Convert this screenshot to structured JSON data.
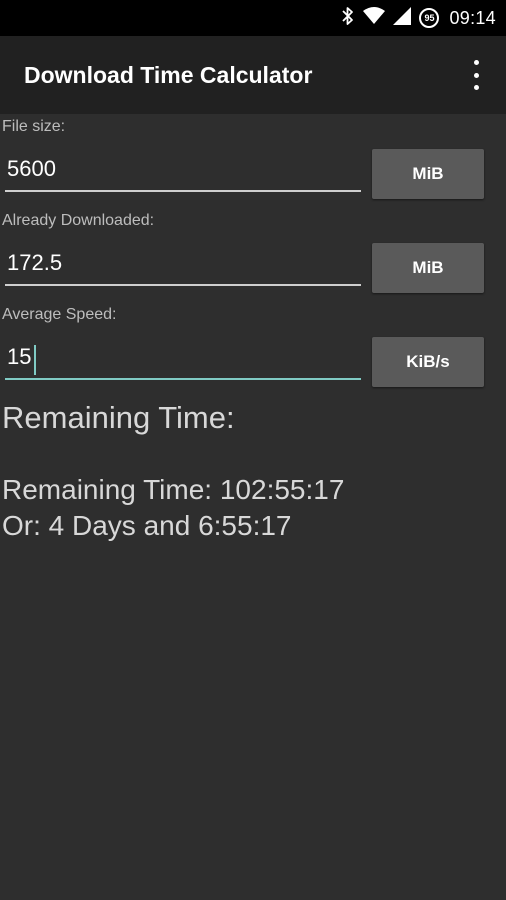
{
  "status_bar": {
    "time": "09:14",
    "battery_level": "95",
    "icons": [
      "bluetooth-icon",
      "wifi-icon",
      "signal-icon",
      "battery-icon"
    ]
  },
  "app_bar": {
    "title": "Download Time Calculator",
    "menu_icon": "overflow-menu-icon"
  },
  "form": {
    "file_size": {
      "label": "File size:",
      "value": "5600",
      "unit": "MiB"
    },
    "already_downloaded": {
      "label": "Already Downloaded:",
      "value": "172.5",
      "unit": "MiB"
    },
    "average_speed": {
      "label": "Average Speed:",
      "value": "15",
      "unit": "KiB/s"
    }
  },
  "result": {
    "heading": "Remaining Time:",
    "line1": "Remaining Time: 102:55:17",
    "line2": "Or: 4 Days and 6:55:17"
  },
  "colors": {
    "background": "#2e2e2e",
    "app_bar": "#212121",
    "status_bar": "#000000",
    "button": "#5a5a5a",
    "accent": "#80cbc4"
  }
}
